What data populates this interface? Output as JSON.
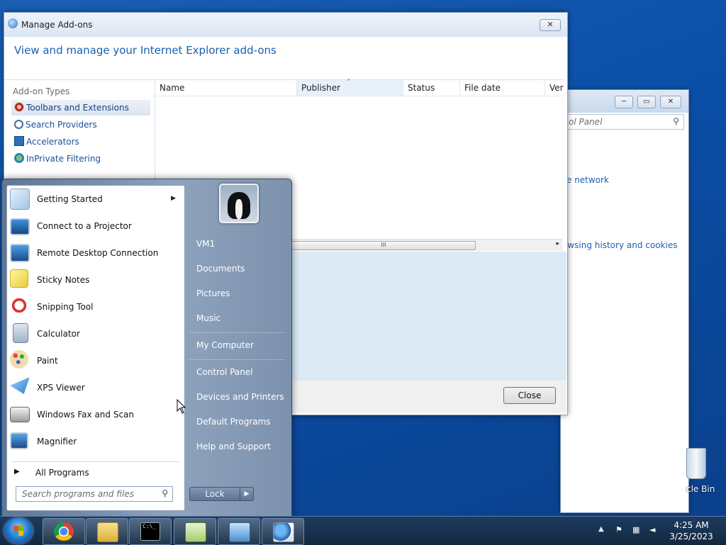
{
  "control_panel": {
    "search_placeholder": "ol Panel",
    "link_network": "e network",
    "link_history": "owsing history and cookies",
    "minimize": "─",
    "maximize": "▭",
    "close": "✕"
  },
  "addons": {
    "title": "Manage Add-ons",
    "heading": "View and manage your Internet Explorer add-ons",
    "types_label": "Add-on Types",
    "types": [
      {
        "label": "Toolbars and Extensions",
        "icon": "gear-icon",
        "selected": true
      },
      {
        "label": "Search Providers",
        "icon": "magnifier-icon",
        "selected": false
      },
      {
        "label": "Accelerators",
        "icon": "accelerator-icon",
        "selected": false
      },
      {
        "label": "InPrivate Filtering",
        "icon": "inprivate-icon",
        "selected": false
      }
    ],
    "columns": [
      "Name",
      "Publisher",
      "Status",
      "File date",
      "Ver"
    ],
    "sort_indicator": "ˆ",
    "scroll_thumb": "III",
    "scroll_right": "▸",
    "close_button": "Close",
    "close_x": "✕"
  },
  "start_menu": {
    "programs": [
      {
        "label": "Getting Started",
        "icon": "getting-started-icon",
        "has_submenu": true
      },
      {
        "label": "Connect to a Projector",
        "icon": "projector-icon",
        "has_submenu": false
      },
      {
        "label": "Remote Desktop Connection",
        "icon": "remote-desktop-icon",
        "has_submenu": false
      },
      {
        "label": "Sticky Notes",
        "icon": "sticky-notes-icon",
        "has_submenu": false
      },
      {
        "label": "Snipping Tool",
        "icon": "snipping-tool-icon",
        "has_submenu": false
      },
      {
        "label": "Calculator",
        "icon": "calculator-icon",
        "has_submenu": false
      },
      {
        "label": "Paint",
        "icon": "paint-icon",
        "has_submenu": false
      },
      {
        "label": "XPS Viewer",
        "icon": "xps-viewer-icon",
        "has_submenu": false
      },
      {
        "label": "Windows Fax and Scan",
        "icon": "fax-scan-icon",
        "has_submenu": false
      },
      {
        "label": "Magnifier",
        "icon": "magnifier-app-icon",
        "has_submenu": false
      }
    ],
    "submenu_arrow": "▶",
    "all_programs": "All Programs",
    "all_programs_arrow": "▶",
    "search_placeholder": "Search programs and files",
    "right_items": {
      "user": "VM1",
      "documents": "Documents",
      "pictures": "Pictures",
      "music": "Music",
      "computer": "My Computer",
      "control_panel": "Control Panel",
      "devices": "Devices and Printers",
      "default_programs": "Default Programs",
      "help": "Help and Support"
    },
    "lock_label": "Lock",
    "lock_arrow": "▶"
  },
  "taskbar": {
    "pinned": [
      {
        "name": "chrome",
        "icon": "chrome-icon"
      },
      {
        "name": "explorer",
        "icon": "folder-icon"
      },
      {
        "name": "cmd",
        "icon": "cmd-icon"
      },
      {
        "name": "notepad",
        "icon": "notepad-icon"
      },
      {
        "name": "control-panel",
        "icon": "control-panel-icon"
      },
      {
        "name": "ie-tools",
        "icon": "ie-checklist-icon"
      }
    ],
    "tray_arrow": "▲",
    "cmd_text": "C:\\_",
    "time": "4:25 AM",
    "date": "3/25/2023"
  },
  "desktop": {
    "recycle_bin": "cle Bin"
  },
  "colors": {
    "accent_link": "#1a5fb0",
    "desktop": "#1a5fb4",
    "details_pane": "#dbeaf5"
  }
}
